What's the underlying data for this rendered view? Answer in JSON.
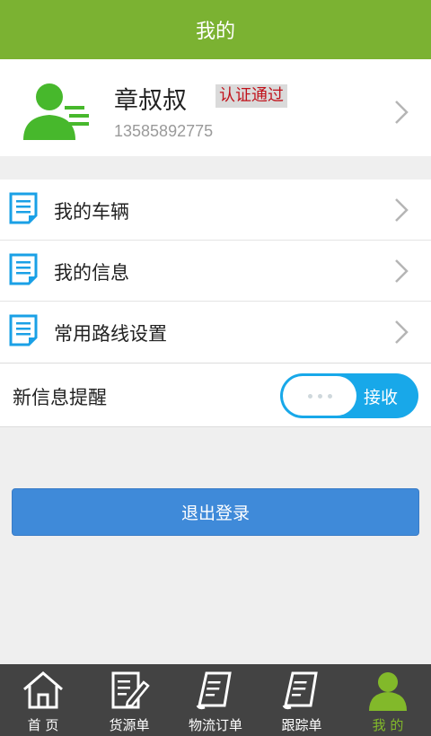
{
  "header": {
    "title": "我的"
  },
  "profile": {
    "name": "章叔叔",
    "verify_badge": "认证通过",
    "phone": "13585892775"
  },
  "menu": {
    "items": [
      {
        "label": "我的车辆",
        "icon": "document-icon"
      },
      {
        "label": "我的信息",
        "icon": "document-icon"
      },
      {
        "label": "常用路线设置",
        "icon": "document-icon"
      }
    ]
  },
  "notification": {
    "label": "新信息提醒",
    "toggle_text": "接收"
  },
  "logout": {
    "label": "退出登录"
  },
  "tabbar": {
    "items": [
      {
        "label": "首 页",
        "icon": "home-icon"
      },
      {
        "label": "货源单",
        "icon": "edit-document-icon"
      },
      {
        "label": "物流订单",
        "icon": "order-scroll-icon"
      },
      {
        "label": "跟踪单",
        "icon": "tracking-scroll-icon"
      },
      {
        "label": "我 的",
        "icon": "person-icon",
        "active": true
      }
    ]
  },
  "colors": {
    "header_bg": "#7bb232",
    "accent_green": "#82b92a",
    "toggle_blue": "#18a8e9",
    "logout_blue": "#3f8ad9",
    "badge_red": "#c1121b",
    "tabbar_bg": "#434343"
  }
}
